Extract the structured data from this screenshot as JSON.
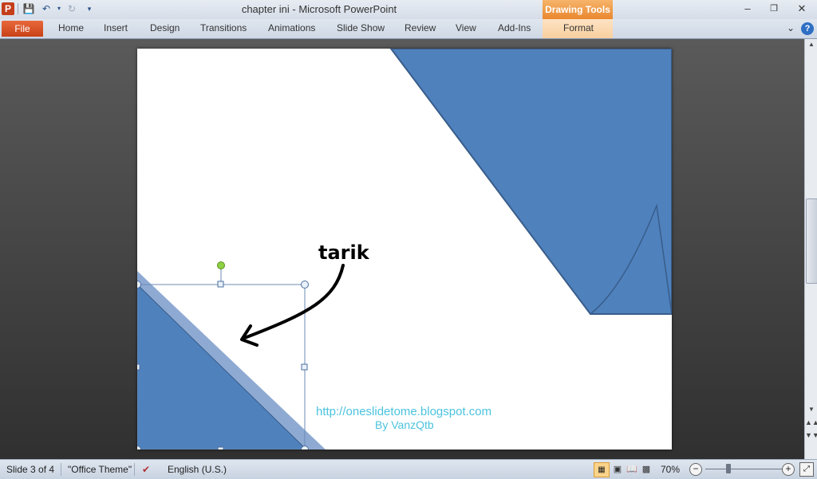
{
  "titlebar": {
    "app_logo": "P",
    "title": "chapter ini  -  Microsoft PowerPoint",
    "contextual_header": "Drawing Tools",
    "icons": [
      "save-icon",
      "undo-icon",
      "redo-icon",
      "customize-qat-icon",
      "minimize-icon",
      "restore-icon",
      "close-icon"
    ]
  },
  "ribbon": {
    "file": "File",
    "tabs": [
      "Home",
      "Insert",
      "Design",
      "Transitions",
      "Animations",
      "Slide Show",
      "Review",
      "View",
      "Add-Ins",
      "Format"
    ],
    "help": "?"
  },
  "slide": {
    "annotation_text": "tarik",
    "footer_url": "http://oneslidetome.blogspot.com",
    "footer_author": "By VanzQtb",
    "shape_fill": "#4f81bd",
    "shape_stroke": "#385d8a",
    "url_color": "#4bc3de"
  },
  "statusbar": {
    "slide_info": "Slide 3 of 4",
    "theme": "\"Office Theme\"",
    "language": "English (U.S.)",
    "zoom": "70%"
  }
}
